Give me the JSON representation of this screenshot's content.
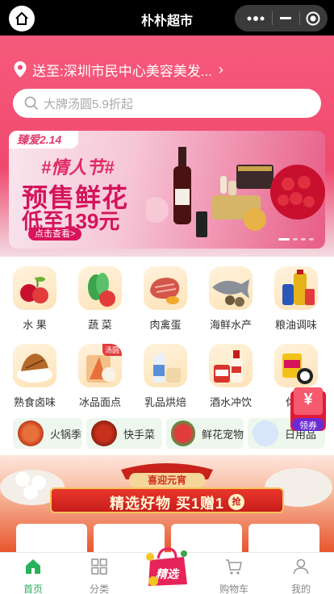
{
  "app": {
    "title": "朴朴超市"
  },
  "location": {
    "text": "送至:深圳市民中心美容美发..."
  },
  "search": {
    "placeholder": "大牌汤圆5.9折起"
  },
  "banner": {
    "tag": "臻爱2.14",
    "line1": "#情人节#",
    "line2": "预售鲜花",
    "line3": "低至139元",
    "button": "点击查看>"
  },
  "categories": [
    {
      "label": "水 果",
      "icon": "fruit-icon",
      "color": "#e23b3b"
    },
    {
      "label": "蔬 菜",
      "icon": "vegetable-icon",
      "color": "#3aa54a"
    },
    {
      "label": "肉禽蛋",
      "icon": "meat-icon",
      "color": "#d4564a"
    },
    {
      "label": "海鲜水产",
      "icon": "seafood-icon",
      "color": "#8a8f98"
    },
    {
      "label": "粮油调味",
      "icon": "oil-icon",
      "color": "#e6b219"
    },
    {
      "label": "熟食卤味",
      "icon": "deli-icon",
      "color": "#b5692a"
    },
    {
      "label": "冰品面点",
      "icon": "frozen-icon",
      "color": "#e8703a",
      "badge": "汤圆"
    },
    {
      "label": "乳品烘焙",
      "icon": "dairy-icon",
      "color": "#5a8fd8"
    },
    {
      "label": "酒水冲饮",
      "icon": "drinks-icon",
      "color": "#d9342b"
    },
    {
      "label": "休闲",
      "icon": "snack-icon",
      "color": "#333333"
    }
  ],
  "quick_links": [
    {
      "label": "火锅季",
      "icon": "hotpot-icon"
    },
    {
      "label": "快手菜",
      "icon": "quick-dish-icon"
    },
    {
      "label": "鲜花宠物",
      "icon": "flower-icon"
    },
    {
      "label": "日用品",
      "icon": "daily-goods-icon"
    }
  ],
  "coupon": {
    "label": "领券",
    "symbol": "¥"
  },
  "promo": {
    "top": "喜迎元宵",
    "main": "精选好物 买1赠1",
    "badge": "抢"
  },
  "tabs": [
    {
      "label": "首页",
      "icon": "home-icon"
    },
    {
      "label": "分类",
      "icon": "category-icon"
    },
    {
      "label": "精选",
      "icon": "featured-icon"
    },
    {
      "label": "购物车",
      "icon": "cart-icon"
    },
    {
      "label": "我的",
      "icon": "profile-icon"
    }
  ],
  "colors": {
    "accent": "#2bb15c",
    "brand": "#ef4a6e"
  }
}
